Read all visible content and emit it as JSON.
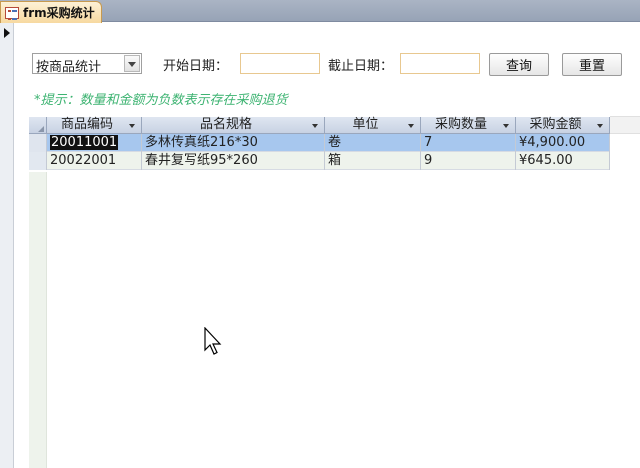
{
  "tab": {
    "title": "frm采购统计"
  },
  "form": {
    "group_by_value": "按商品统计",
    "start_date_label": "开始日期：",
    "start_date_value": "",
    "end_date_label": "截止日期：",
    "end_date_value": "",
    "query_button": "查询",
    "reset_button": "重置",
    "hint": "*提示：数量和金额为负数表示存在采购退货"
  },
  "table": {
    "columns": [
      "商品编码",
      "品名规格",
      "单位",
      "采购数量",
      "采购金额"
    ],
    "rows": [
      [
        "20011001",
        "多林传真纸216*30",
        "卷",
        "7",
        "¥4,900.00"
      ],
      [
        "20022001",
        "春井复写纸95*260",
        "箱",
        "9",
        "¥645.00"
      ]
    ]
  },
  "colors": {
    "selected_row": "#a7c7ee",
    "hint_text": "#3cb371",
    "tab_bg": "#f7d9a0"
  }
}
